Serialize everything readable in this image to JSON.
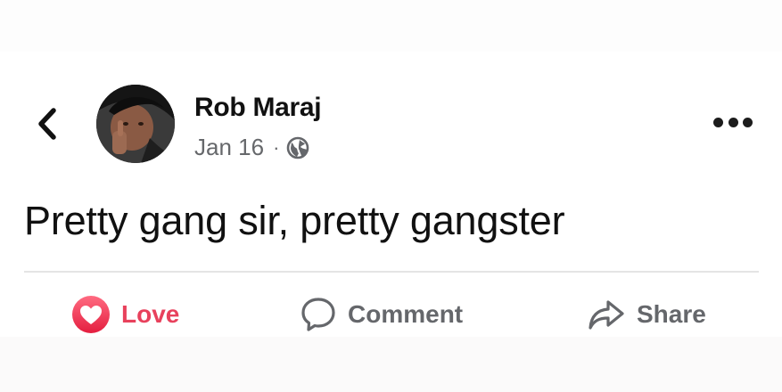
{
  "post": {
    "author": "Rob Maraj",
    "date": "Jan 16",
    "separator": "·",
    "text": "Pretty gang sir, pretty gangster"
  },
  "actions": {
    "love_label": "Love",
    "comment_label": "Comment",
    "share_label": "Share"
  },
  "icons": {
    "back": "chevron-left-icon",
    "privacy": "globe-icon",
    "more": "more-horizontal-icon",
    "love": "love-reaction-icon",
    "comment": "comment-icon",
    "share": "share-arrow-icon"
  },
  "colors": {
    "love": "#e8415c",
    "secondary_text": "#65676b",
    "primary_text": "#111111"
  }
}
